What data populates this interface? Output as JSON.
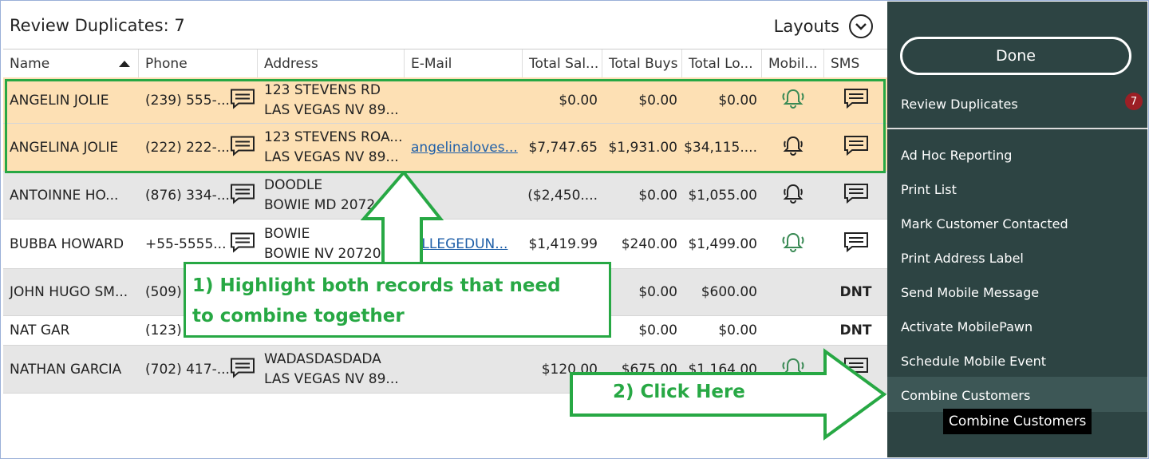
{
  "header": {
    "title": "Review Duplicates: 7",
    "layouts_label": "Layouts"
  },
  "columns": [
    "Name",
    "Phone",
    "Address",
    "E-Mail",
    "Total Sal...",
    "Total Buys",
    "Total Lo...",
    "Mobil...",
    "SMS"
  ],
  "rows": [
    {
      "name": "ANGELIN JOLIE",
      "phone": "(239) 555-...",
      "addr1": "123 STEVENS RD",
      "addr2": "LAS VEGAS NV 89...",
      "email": "",
      "sales": "$0.00",
      "buys": "$0.00",
      "loans": "$0.00",
      "mobile": "bell-active",
      "sms": "chat"
    },
    {
      "name": "ANGELINA JOLIE",
      "phone": "(222) 222-...",
      "addr1": "123 STEVENS ROA...",
      "addr2": "LAS VEGAS NV 89...",
      "email": "angelinaloves...",
      "sales": "$7,747.65",
      "buys": "$1,931.00",
      "loans": "$34,115....",
      "mobile": "bell-plain",
      "sms": "chat"
    },
    {
      "name": "ANTOINNE HO...",
      "phone": "(876) 334-...",
      "addr1": "DOODLE",
      "addr2": "BOWIE MD 2072",
      "email": "",
      "sales": "($2,450....",
      "buys": "$0.00",
      "loans": "$1,055.00",
      "mobile": "bell-plain",
      "sms": "chat"
    },
    {
      "name": "BUBBA HOWARD",
      "phone": "+55-5555...",
      "addr1": "BOWIE",
      "addr2": "BOWIE NV 20720",
      "email": "OLLEGEDUN...",
      "sales": "$1,419.99",
      "buys": "$240.00",
      "loans": "$1,499.00",
      "mobile": "bell-active",
      "sms": "chat"
    },
    {
      "name": "JOHN HUGO SM...",
      "phone": "(509)",
      "addr1": "",
      "addr2": "",
      "email": "",
      "sales": "",
      "buys": "$0.00",
      "loans": "$600.00",
      "mobile": "",
      "sms": "DNT"
    },
    {
      "name": "NAT GAR",
      "phone": "(123)",
      "addr1": "",
      "addr2": "",
      "email": "",
      "sales": "",
      "buys": "$0.00",
      "loans": "$0.00",
      "mobile": "",
      "sms": "DNT"
    },
    {
      "name": "NATHAN GARCIA",
      "phone": "(702) 417-...",
      "addr1": "WADASDASDADA",
      "addr2": "LAS VEGAS NV 89...",
      "email": "",
      "sales": "$120.00",
      "buys": "$675.00",
      "loans": "$1,164.00",
      "mobile": "bell-active",
      "sms": "chat"
    }
  ],
  "panel": {
    "done_label": "Done",
    "review_label": "Review Duplicates",
    "review_count": "7",
    "items": [
      "Ad Hoc Reporting",
      "Print List",
      "Mark Customer Contacted",
      "Print Address Label",
      "Send Mobile Message",
      "Activate MobilePawn",
      "Schedule Mobile Event",
      "Combine Customers"
    ],
    "tooltip": "Combine Customers"
  },
  "annotations": {
    "step1_line1": "1) Highlight both records that need",
    "step1_line2": "to combine together",
    "step2": "2) Click Here"
  },
  "colors": {
    "highlight_green": "#27a844",
    "selected_row": "#fde0b4",
    "panel_bg": "#2d4443",
    "badge": "#9c1f25"
  }
}
